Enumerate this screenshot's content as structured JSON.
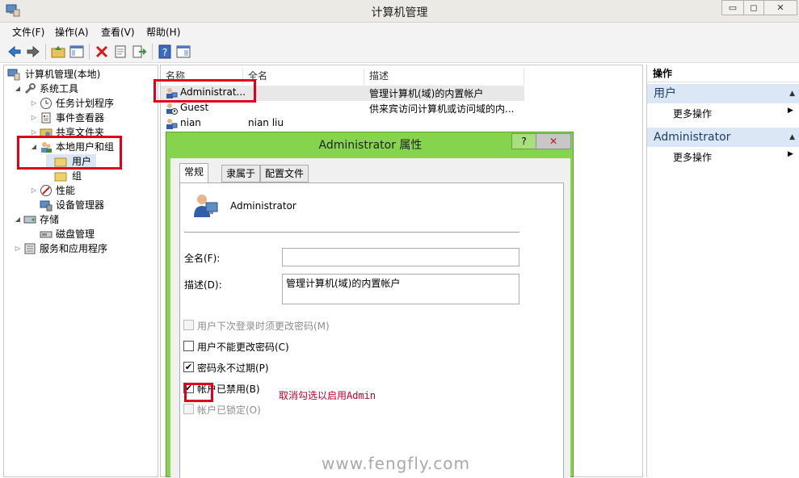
{
  "window": {
    "title": "计算机管理",
    "minimize": "▭",
    "restore": "◻",
    "close": "✕"
  },
  "menu": [
    "文件(F)",
    "操作(A)",
    "查看(V)",
    "帮助(H)"
  ],
  "tree": {
    "root": "计算机管理(本地)",
    "system_tools": "系统工具",
    "task_scheduler": "任务计划程序",
    "event_viewer": "事件查看器",
    "shared_folders": "共享文件夹",
    "local_users_groups": "本地用户和组",
    "users": "用户",
    "groups": "组",
    "performance": "性能",
    "device_manager": "设备管理器",
    "storage": "存储",
    "disk_management": "磁盘管理",
    "services_apps": "服务和应用程序"
  },
  "list": {
    "columns": [
      "名称",
      "全名",
      "描述"
    ],
    "rows": [
      {
        "name": "Administrat...",
        "fullname": "",
        "desc": "管理计算机(域)的内置帐户"
      },
      {
        "name": "Guest",
        "fullname": "",
        "desc": "供来宾访问计算机或访问域的内..."
      },
      {
        "name": "nian",
        "fullname": "nian liu",
        "desc": ""
      }
    ]
  },
  "actions": {
    "title": "操作",
    "section1": "用户",
    "section1_item": "更多操作",
    "section2": "Administrator",
    "section2_item": "更多操作"
  },
  "dialog": {
    "title": "Administrator 属性",
    "help": "?",
    "tabs": [
      "常规",
      "隶属于",
      "配置文件"
    ],
    "username": "Administrator",
    "fullname_label": "全名(F):",
    "fullname_value": "",
    "desc_label": "描述(D):",
    "desc_value": "管理计算机(域)的内置帐户",
    "cb_must_change": "用户下次登录时须更改密码(M)",
    "cb_cannot_change": "用户不能更改密码(C)",
    "cb_never_expires": "密码永不过期(P)",
    "cb_disabled": "帐户已禁用(B)",
    "cb_locked": "帐户已锁定(O)",
    "states": {
      "must_change": false,
      "cannot_change": false,
      "never_expires": true,
      "disabled": true,
      "locked": false
    }
  },
  "annotation": "取消勾选以启用Admin",
  "watermark": "www.fengfly.com",
  "colors": {
    "dialog_frame": "#86d44e",
    "highlight_box": "#e0001b",
    "actions_section": "#dbe7f4"
  }
}
